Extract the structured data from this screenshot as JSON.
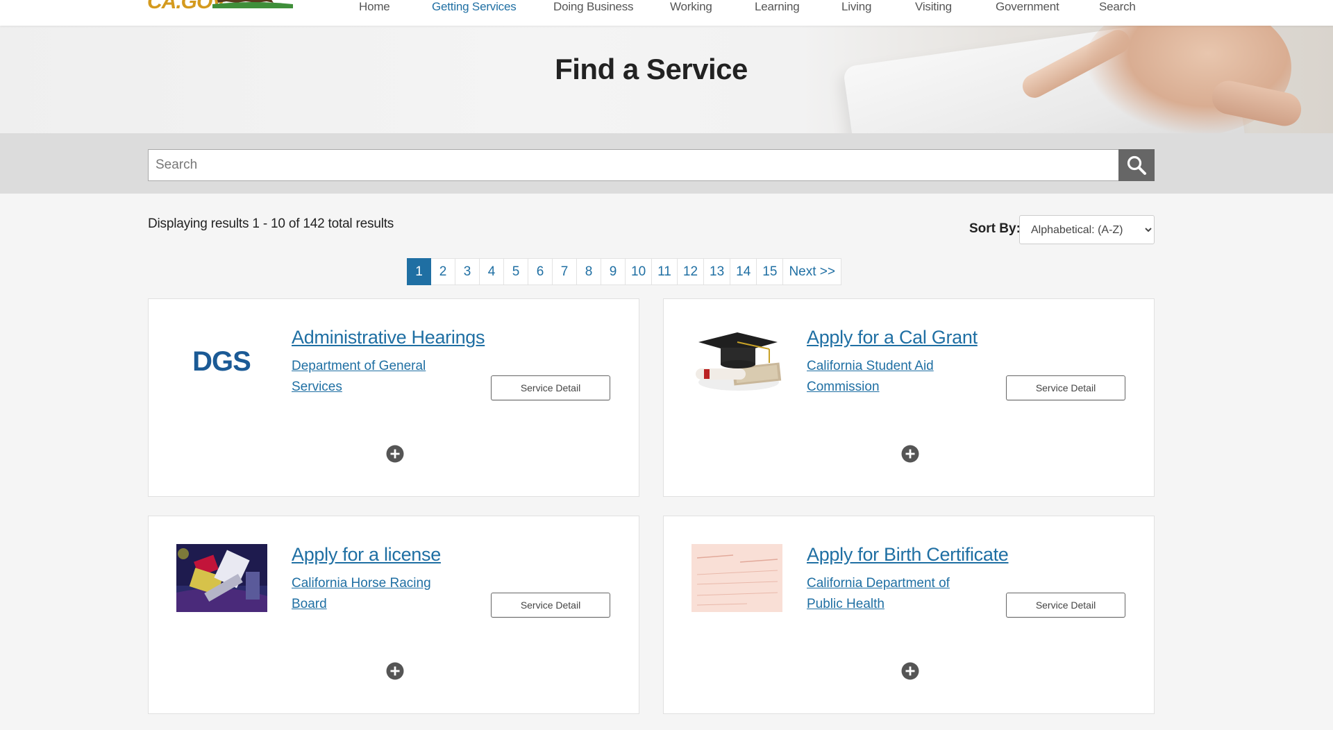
{
  "header": {
    "logo_text": "CA.GOV",
    "nav": [
      {
        "label": "Home",
        "active": false
      },
      {
        "label": "Getting Services",
        "active": true
      },
      {
        "label": "Doing Business",
        "active": false
      },
      {
        "label": "Working",
        "active": false
      },
      {
        "label": "Learning",
        "active": false
      },
      {
        "label": "Living",
        "active": false
      },
      {
        "label": "Visiting",
        "active": false
      },
      {
        "label": "Government",
        "active": false
      },
      {
        "label": "Search",
        "active": false
      }
    ]
  },
  "hero": {
    "title": "Find a Service"
  },
  "search": {
    "placeholder": "Search",
    "value": ""
  },
  "results": {
    "summary": "Displaying results 1 - 10 of 142 total results",
    "sort_label": "Sort By:",
    "sort_selected": "Alphabetical: (A-Z)"
  },
  "pagination": {
    "pages": [
      "1",
      "2",
      "3",
      "4",
      "5",
      "6",
      "7",
      "8",
      "9",
      "10",
      "11",
      "12",
      "13",
      "14",
      "15"
    ],
    "current": "1",
    "next_label": "Next >>"
  },
  "cards": [
    {
      "title": "Administrative Hearings",
      "agency": "Department of General Services",
      "button": "Service Detail",
      "image_text": "DGS"
    },
    {
      "title": "Apply for a Cal Grant",
      "agency": "California Student Aid Commission",
      "button": "Service Detail"
    },
    {
      "title": "Apply for a license",
      "agency": "California Horse Racing Board",
      "button": "Service Detail"
    },
    {
      "title": "Apply for Birth Certificate",
      "agency": "California Department of Public Health",
      "button": "Service Detail"
    }
  ],
  "colors": {
    "link": "#1f6fa3",
    "active_page": "#1f6fa3",
    "search_button": "#666666",
    "search_band": "#dcdcdc"
  }
}
